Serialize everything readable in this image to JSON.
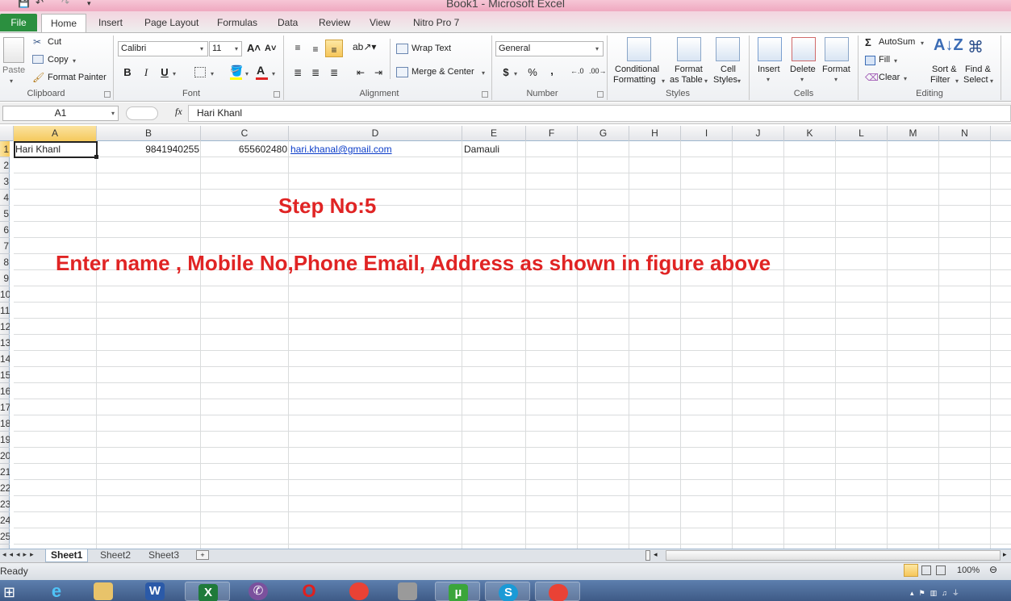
{
  "window": {
    "title": "Book1  -  Microsoft Excel"
  },
  "tabs": [
    {
      "label": "File"
    },
    {
      "label": "Home"
    },
    {
      "label": "Insert"
    },
    {
      "label": "Page Layout"
    },
    {
      "label": "Formulas"
    },
    {
      "label": "Data"
    },
    {
      "label": "Review"
    },
    {
      "label": "View"
    },
    {
      "label": "Nitro Pro 7"
    }
  ],
  "ribbon": {
    "clipboard": {
      "group": "Clipboard",
      "paste": "Paste",
      "cut": "Cut",
      "copy": "Copy",
      "format_painter": "Format Painter"
    },
    "font": {
      "group": "Font",
      "font_name": "Calibri",
      "font_size": "11",
      "bold": "B",
      "italic": "I",
      "underline": "U"
    },
    "alignment": {
      "group": "Alignment",
      "wrap_text": "Wrap Text",
      "merge_center": "Merge & Center"
    },
    "number": {
      "group": "Number",
      "format": "General",
      "currency": "$",
      "percent": "%",
      "comma": ","
    },
    "styles": {
      "group": "Styles",
      "conditional_1": "Conditional",
      "conditional_2": "Formatting",
      "format_table_1": "Format",
      "format_table_2": "as Table",
      "cell_styles_1": "Cell",
      "cell_styles_2": "Styles"
    },
    "cells": {
      "group": "Cells",
      "insert": "Insert",
      "delete": "Delete",
      "format": "Format"
    },
    "editing": {
      "group": "Editing",
      "autosum": "AutoSum",
      "fill": "Fill",
      "clear": "Clear",
      "sort_1": "Sort &",
      "sort_2": "Filter",
      "find_1": "Find &",
      "find_2": "Select"
    }
  },
  "formula_bar": {
    "name_box": "A1",
    "fx": "fx",
    "content": "Hari Khanl"
  },
  "columns": [
    "A",
    "B",
    "C",
    "D",
    "E",
    "F",
    "G",
    "H",
    "I",
    "J",
    "K",
    "L",
    "M",
    "N"
  ],
  "rows": [
    "1",
    "2",
    "3",
    "4",
    "5",
    "6",
    "7",
    "8",
    "9",
    "10",
    "11",
    "12",
    "13",
    "14",
    "15",
    "16",
    "17",
    "18",
    "19",
    "20",
    "21",
    "22",
    "23",
    "24",
    "25"
  ],
  "cells": {
    "A1": "Hari Khanl",
    "B1": "9841940255",
    "C1": "655602480",
    "D1": "hari.khanal@gmail.com",
    "E1": "Damauli"
  },
  "annotation": {
    "step": "Step No:5",
    "instruction": "Enter name , Mobile No,Phone Email,  Address as shown in figure above"
  },
  "sheets": [
    "Sheet1",
    "Sheet2",
    "Sheet3"
  ],
  "status": {
    "mode": "Ready",
    "zoom": "100%"
  },
  "colors": {
    "accent_green": "#2b8f3f",
    "annotation_red": "#e02424",
    "link_blue": "#0a3cc8"
  }
}
